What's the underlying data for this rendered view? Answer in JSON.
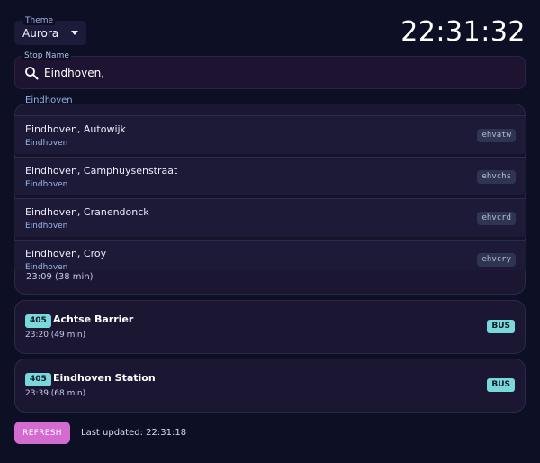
{
  "theme": {
    "label": "Theme",
    "value": "Aurora"
  },
  "clock": "22:31:32",
  "search": {
    "label": "Stop Name",
    "value": "Eindhoven,"
  },
  "suggestions": {
    "partial_city": "Eindhoven",
    "items": [
      {
        "name": "Eindhoven, Autowijk",
        "city": "Eindhoven",
        "code": "ehvatw"
      },
      {
        "name": "Eindhoven, Camphuysenstraat",
        "city": "Eindhoven",
        "code": "ehvchs"
      },
      {
        "name": "Eindhoven, Cranendonck",
        "city": "Eindhoven",
        "code": "ehvcrd"
      },
      {
        "name": "Eindhoven, Croy",
        "city": "Eindhoven",
        "code": "ehvcry"
      }
    ]
  },
  "departures": [
    {
      "time": "23:09 (38 min)"
    },
    {
      "route": "405",
      "destination": "Achtse Barrier",
      "time": "23:20 (49 min)",
      "mode": "BUS"
    },
    {
      "route": "405",
      "destination": "Eindhoven Station",
      "time": "23:39 (68 min)",
      "mode": "BUS"
    }
  ],
  "footer": {
    "refresh_label": "REFRESH",
    "last_updated": "Last updated: 22:31:18"
  },
  "colors": {
    "background": "#0d0f24",
    "accent": "#7ad8da",
    "button": "#d46bd0"
  }
}
